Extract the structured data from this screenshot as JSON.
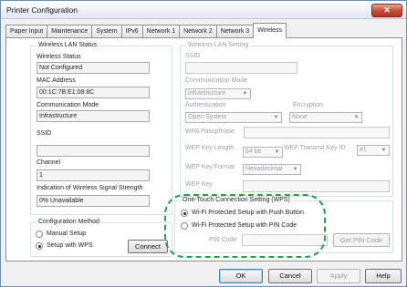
{
  "window": {
    "title": "Printer Configuration",
    "close_glyph": "✕"
  },
  "tabs": [
    {
      "label": "Paper Input"
    },
    {
      "label": "Maintenance"
    },
    {
      "label": "System"
    },
    {
      "label": "IPv6"
    },
    {
      "label": "Network 1"
    },
    {
      "label": "Network 2"
    },
    {
      "label": "Network 3"
    },
    {
      "label": "Wireless",
      "active": true
    }
  ],
  "status": {
    "group_title": "Wireless LAN Status",
    "wireless_status_label": "Wireless Status",
    "wireless_status_value": "Not Configured",
    "mac_label": "MAC Address",
    "mac_value": "00:1C:7B:E1:08:8C",
    "comm_mode_label": "Communication Mode",
    "comm_mode_value": "Infrastructure",
    "ssid_label": "SSID",
    "ssid_value": "",
    "channel_label": "Channel",
    "channel_value": "1",
    "signal_label": "Indication of Wireless Signal Strength",
    "signal_value": "0% Unavailable"
  },
  "config_method": {
    "group_title": "Configuration Method",
    "manual_label": "Manual Setup",
    "wps_label": "Setup with WPS",
    "connect_label": "Connect",
    "selected": "wps"
  },
  "lan_setting": {
    "group_title": "Wireless LAN Setting",
    "ssid_label": "SSID",
    "comm_mode_label": "Communication Mode",
    "comm_mode_value": "Infrastructure",
    "auth_label": "Authentication",
    "auth_value": "Open System",
    "encryption_label": "Encryption",
    "encryption_value": "None",
    "wpa_label": "WPA Passphrase",
    "wep_len_label": "WEP Key Length",
    "wep_len_value": "64 bit",
    "wep_tx_label": "WEP Transmit Key ID",
    "wep_tx_value": "#1",
    "wep_format_label": "WEP Key Format",
    "wep_format_value": "Hexadecimal",
    "wep_key_label": "WEP Key"
  },
  "wps": {
    "group_title": "One-Touch Connection Setting (WPS)",
    "push_label": "Wi-Fi Protected Setup with Push Button",
    "pin_label": "Wi-Fi Protected Setup with PIN Code",
    "pin_code_label": "PIN Code",
    "get_pin_label": "Get PIN Code",
    "selected": "push",
    "highlight_color": "#2a9d4b"
  },
  "footer": {
    "ok": "OK",
    "cancel": "Cancel",
    "apply": "Apply",
    "help": "Help"
  }
}
